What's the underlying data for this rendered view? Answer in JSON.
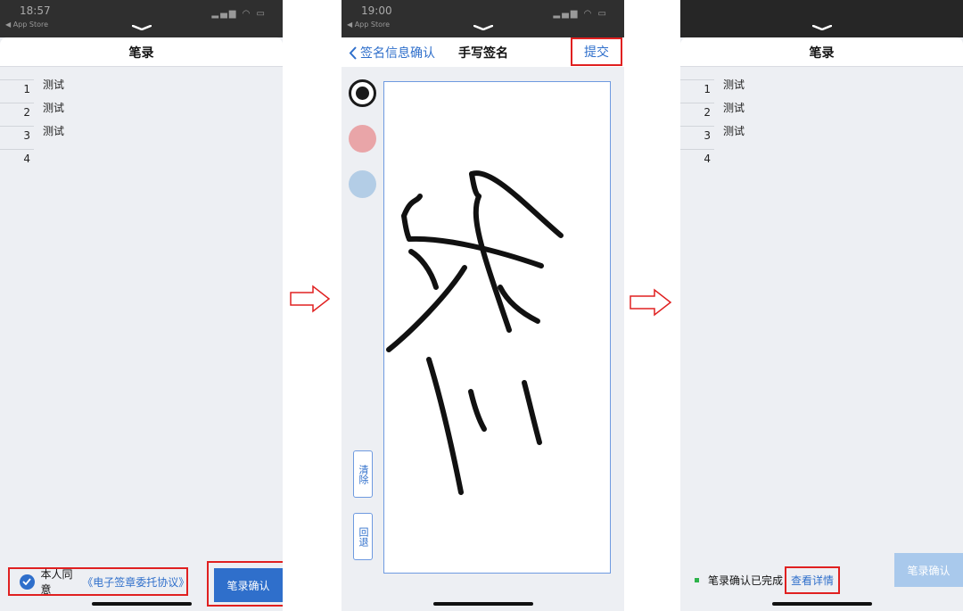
{
  "screen1": {
    "status_time": "18:57",
    "back_app": "◀ App Store",
    "title": "笔录",
    "lines": [
      {
        "num": "1",
        "text": "测试"
      },
      {
        "num": "2",
        "text": "测试"
      },
      {
        "num": "3",
        "text": "测试"
      },
      {
        "num": "4",
        "text": ""
      }
    ],
    "agree_prefix": "本人同意",
    "agree_link": "《电子签章委托协议》",
    "confirm_label": "笔录确认"
  },
  "screen2": {
    "status_time": "19:00",
    "back_app": "◀ App Store",
    "back_label": "签名信息确认",
    "title": "手写签名",
    "submit_label": "提交",
    "clear_label": "清除",
    "undo_label": "回退",
    "pen_colors": [
      "#1a1a1a",
      "#e9a5a8",
      "#b3cde6"
    ]
  },
  "screen3": {
    "title": "笔录",
    "lines": [
      {
        "num": "1",
        "text": "测试"
      },
      {
        "num": "2",
        "text": "测试"
      },
      {
        "num": "3",
        "text": "测试"
      },
      {
        "num": "4",
        "text": ""
      }
    ],
    "done_text": "笔录确认已完成",
    "detail_link": "查看详情",
    "confirm_label": "笔录确认"
  },
  "colors": {
    "accent": "#2f6fcb",
    "highlight": "#e02020",
    "complete": "#2db34a",
    "disabled_button": "#a9c9ec"
  }
}
